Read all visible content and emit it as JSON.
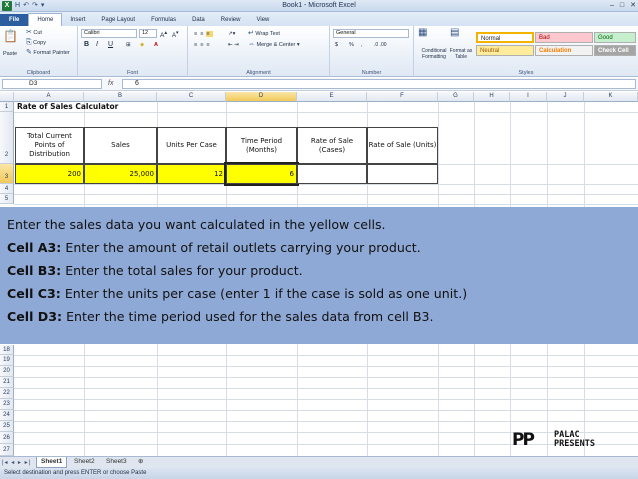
{
  "window": {
    "title": "Book1 - Microsoft Excel",
    "qat": [
      "X",
      "H",
      "↶",
      "↷",
      "▾"
    ],
    "controls": [
      "–",
      "□",
      "✕"
    ]
  },
  "ribbon_tabs": [
    "File",
    "Home",
    "Insert",
    "Page Layout",
    "Formulas",
    "Data",
    "Review",
    "View"
  ],
  "ribbon": {
    "clipboard": {
      "cut": "Cut",
      "copy": "Copy",
      "paste": "Paste",
      "format_painter": "Format Painter",
      "label": "Clipboard"
    },
    "font": {
      "name": "Calibri",
      "size": "12",
      "bold": "B",
      "italic": "I",
      "underline": "U",
      "label": "Font"
    },
    "alignment": {
      "wrap_text": "Wrap Text",
      "merge": "Merge & Center",
      "label": "Alignment"
    },
    "number": {
      "format": "General",
      "currency": "$",
      "percent": "%",
      "comma": ",",
      "label": "Number"
    },
    "styles": {
      "conditional": "Conditional Formatting",
      "format_as_table": "Format as Table",
      "cells": [
        "Normal",
        "Bad",
        "Good",
        "Neutral",
        "Calculation",
        "Check Cell"
      ],
      "label": "Styles",
      "colors": {
        "normal": "#ffffff",
        "bad": "#ffc7ce",
        "good": "#c6efce",
        "neutral": "#ffeb9c",
        "calculation": "#f2f2f2",
        "check": "#a5a5a5"
      }
    }
  },
  "formula_bar": {
    "name_box": "D3",
    "fx": "fx",
    "value": "6"
  },
  "columns": [
    "A",
    "B",
    "C",
    "D",
    "E",
    "F",
    "G",
    "H",
    "I",
    "J",
    "K"
  ],
  "selected_column": "D",
  "rows": [
    "1",
    "2",
    "3",
    "4",
    "5",
    "18",
    "19",
    "20",
    "21",
    "22",
    "23",
    "24",
    "25",
    "26",
    "27"
  ],
  "sheet": {
    "title": "Rate of Sales Calculator",
    "headers": [
      "Total Current Points of Distribution",
      "Sales",
      "Units Per Case",
      "Time Period (Months)",
      "Rate of Sale (Cases)",
      "Rate of Sale (Units)"
    ],
    "values": [
      "200",
      "25,000",
      "12",
      "6",
      "",
      ""
    ]
  },
  "overlay": {
    "intro": "Enter the sales data you want calculated in the yellow cells.",
    "items": [
      {
        "key": "Cell A3:",
        "text": " Enter the amount of retail outlets carrying your product."
      },
      {
        "key": "Cell B3:",
        "text": " Enter the total sales for your product."
      },
      {
        "key": "Cell C3:",
        "text": " Enter the units per case (enter 1 if the case is sold as one unit.)"
      },
      {
        "key": "Cell D3:",
        "text": " Enter the time period used for the sales data from cell B3."
      }
    ]
  },
  "logo": {
    "mark": "PP",
    "line1": "PALAC",
    "line2": "PRESENTS"
  },
  "sheet_tabs": [
    "Sheet1",
    "Sheet2",
    "Sheet3"
  ],
  "status": "Select destination and press ENTER or choose Paste",
  "colors": {
    "input_yellow": "#ffff00",
    "overlay_blue": "#8fa9d6",
    "file_tab": "#2c5d9e"
  }
}
